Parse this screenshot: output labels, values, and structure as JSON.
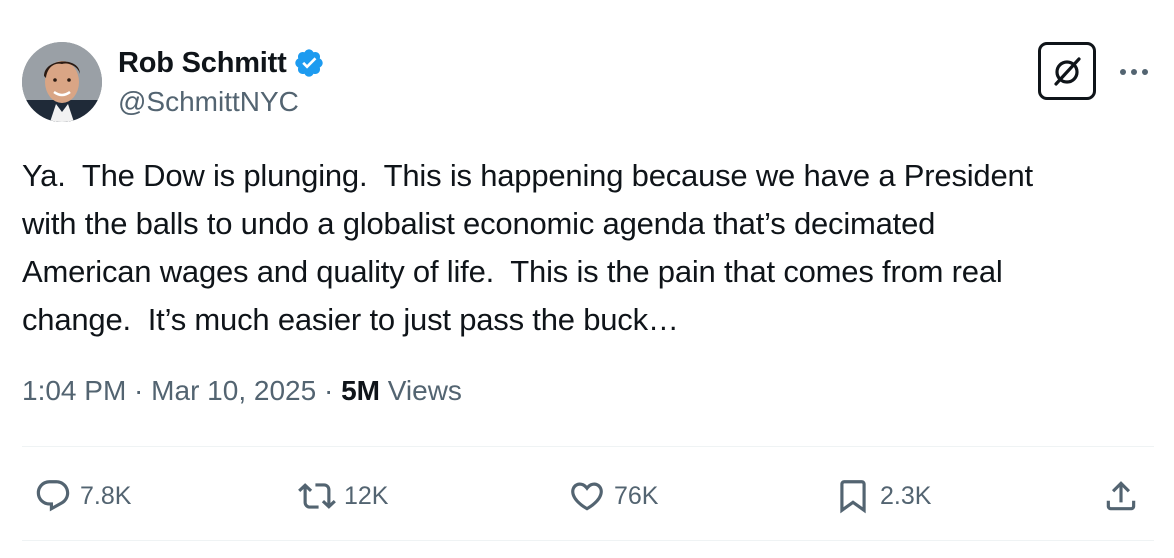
{
  "author": {
    "display_name": "Rob Schmitt",
    "handle": "@SchmittNYC",
    "verified": true,
    "verified_color": "#1d9bf0"
  },
  "header_actions": {
    "grok_icon": "grok-icon",
    "more_icon": "more-icon"
  },
  "tweet": {
    "lines": [
      "Ya.  The Dow is plunging.  This is happening because we have a President",
      "with the balls to undo a globalist economic agenda that’s decimated",
      "American wages and quality of life.  This is the pain that comes from real",
      "change.  It’s much easier to just pass the buck…"
    ]
  },
  "meta": {
    "time": "1:04 PM",
    "separator": " · ",
    "date": "Mar 10, 2025",
    "views_count": "5M",
    "views_label": " Views"
  },
  "actions": {
    "replies": "7.8K",
    "reposts": "12K",
    "likes": "76K",
    "bookmarks": "2.3K"
  },
  "colors": {
    "text": "#0f1419",
    "secondary": "#536471",
    "divider": "#eff3f4"
  }
}
